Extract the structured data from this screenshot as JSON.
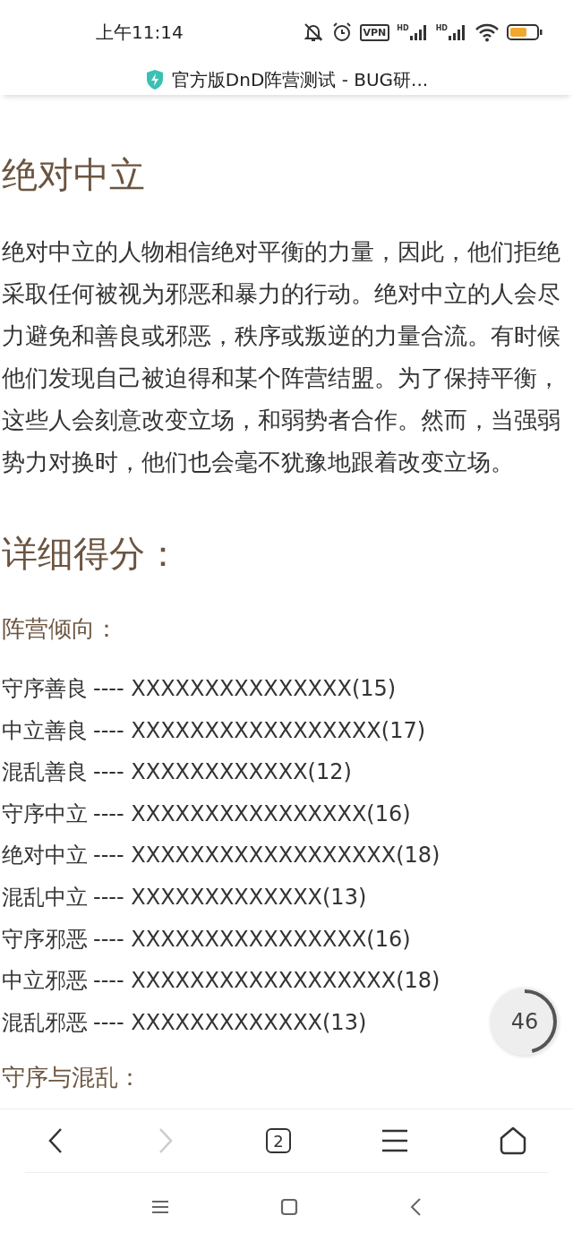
{
  "status_bar": {
    "time": "上午11:14",
    "vpn": "VPN",
    "signal_labels": [
      "HD",
      "HD"
    ]
  },
  "address_bar": {
    "title": "官方版DnD阵营测试 - BUG研..."
  },
  "article": {
    "heading": "绝对中立",
    "paragraph": "绝对中立的人物相信绝对平衡的力量，因此，他们拒绝采取任何被视为邪恶和暴力的行动。绝对中立的人会尽力避免和善良或邪恶，秩序或叛逆的力量合流。有时候他们发现自己被迫得和某个阵营结盟。为了保持平衡，这些人会刻意改变立场，和弱势者合作。然而，当强弱势力对换时，他们也会毫不犹豫地跟着改变立场。",
    "scores_heading": "详细得分：",
    "subheading": "阵营倾向：",
    "scores": [
      {
        "label": "守序善良",
        "bar": "---- XXXXXXXXXXXXXXX(15)"
      },
      {
        "label": "中立善良",
        "bar": "---- XXXXXXXXXXXXXXXXX(17)"
      },
      {
        "label": "混乱善良",
        "bar": "---- XXXXXXXXXXXX(12)"
      },
      {
        "label": "守序中立",
        "bar": "---- XXXXXXXXXXXXXXXX(16)"
      },
      {
        "label": "绝对中立",
        "bar": "---- XXXXXXXXXXXXXXXXXX(18)"
      },
      {
        "label": "混乱中立",
        "bar": "---- XXXXXXXXXXXXX(13)"
      },
      {
        "label": "守序邪恶",
        "bar": "---- XXXXXXXXXXXXXXXX(16)"
      },
      {
        "label": "中立邪恶",
        "bar": "---- XXXXXXXXXXXXXXXXXX(18)"
      },
      {
        "label": "混乱邪恶",
        "bar": "---- XXXXXXXXXXXXX(13)"
      }
    ],
    "next_subheading": "守序与混乱："
  },
  "scroll_progress": {
    "value": "46",
    "level": 0.46
  },
  "browser_toolbar": {
    "back": {
      "disabled": false
    },
    "forward": {
      "disabled": true
    },
    "tab_count": "2"
  }
}
